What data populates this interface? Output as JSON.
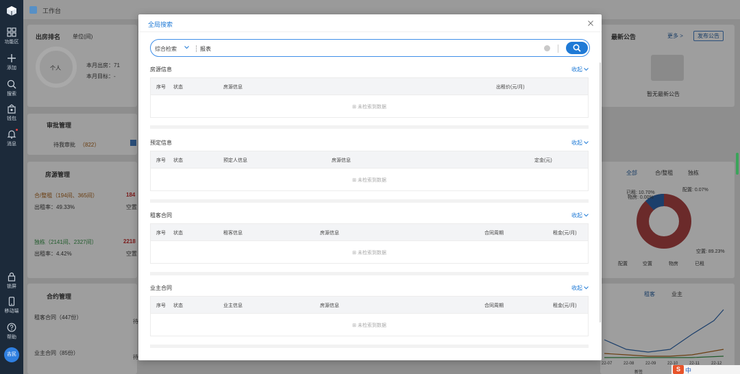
{
  "sidebar": {
    "items": [
      {
        "label": "功能区",
        "icon": "grid-icon"
      },
      {
        "label": "添加",
        "icon": "plus-icon"
      },
      {
        "label": "搜索",
        "icon": "search-icon"
      },
      {
        "label": "钱包",
        "icon": "wallet-icon"
      },
      {
        "label": "消息",
        "icon": "bell-icon"
      }
    ],
    "bottom_items": [
      {
        "label": "锁屏",
        "icon": "lock-icon"
      },
      {
        "label": "移动端",
        "icon": "phone-icon"
      },
      {
        "label": "帮助",
        "icon": "help-icon"
      }
    ],
    "avatar_text": "吉民"
  },
  "topbar": {
    "title": "工作台"
  },
  "background": {
    "rank": {
      "title": "出房排名",
      "unit": "单位(间)",
      "avatar": "个人",
      "month_out": "本月出房：71",
      "month_target": "本月目标：-"
    },
    "approval": {
      "title": "审批管理",
      "pending": "待我审批",
      "pending_count": "（822）"
    },
    "rooms": {
      "title": "房源管理",
      "row1": "合/整租（194间、365间）",
      "row1_val": "184",
      "row1_rate": "出租率：49.33%",
      "row1_sub": "空置",
      "row2": "独栋（2141间、2327间）",
      "row2_val": "2218",
      "row2_rate": "出租率：4.42%",
      "row2_sub": "空置"
    },
    "contracts": {
      "title": "合约管理",
      "tenant": "租客合同（447份）",
      "owner": "业主合同（85份）",
      "suffix": "待"
    },
    "notice": {
      "title": "最新公告",
      "more": "更多 >",
      "publish": "发布公告",
      "empty": "暂无最新公告"
    },
    "donut": {
      "tabs": [
        "全部",
        "合/整租",
        "独栋"
      ],
      "labels": {
        "rented": "已租: 10.70%",
        "booked": "配置: 0.07%",
        "sub": "物房: 0.00%",
        "empty": "空置: 89.23%"
      },
      "legend": [
        "配置",
        "空置",
        "物房",
        "已租"
      ]
    },
    "trend": {
      "tabs": [
        "租客",
        "业主"
      ],
      "xticks": [
        "22-07",
        "22-08",
        "22-09",
        "22-10",
        "22-11",
        "22-12"
      ],
      "legend": [
        "新签"
      ]
    }
  },
  "modal": {
    "title": "全局搜索",
    "search": {
      "type_label": "综合检索",
      "value": "报表",
      "placeholder": ""
    },
    "sections": [
      {
        "title": "房源信息",
        "toggle": "收起",
        "columns": [
          "序号",
          "状态",
          "房源信息",
          "出租价(元/月)"
        ],
        "empty": "未检索到数据"
      },
      {
        "title": "预定信息",
        "toggle": "收起",
        "columns": [
          "序号",
          "状态",
          "预定人信息",
          "房源信息",
          "定金(元)"
        ],
        "empty": "未检索到数据"
      },
      {
        "title": "租客合同",
        "toggle": "收起",
        "columns": [
          "序号",
          "状态",
          "租客信息",
          "房源信息",
          "合同周期",
          "租金(元/月)"
        ],
        "empty": "未检索到数据"
      },
      {
        "title": "业主合同",
        "toggle": "收起",
        "columns": [
          "序号",
          "状态",
          "业主信息",
          "房源信息",
          "合同周期",
          "租金(元/月)"
        ],
        "empty": "未检索到数据"
      }
    ]
  },
  "ime": {
    "logo": "S",
    "text": "中"
  }
}
